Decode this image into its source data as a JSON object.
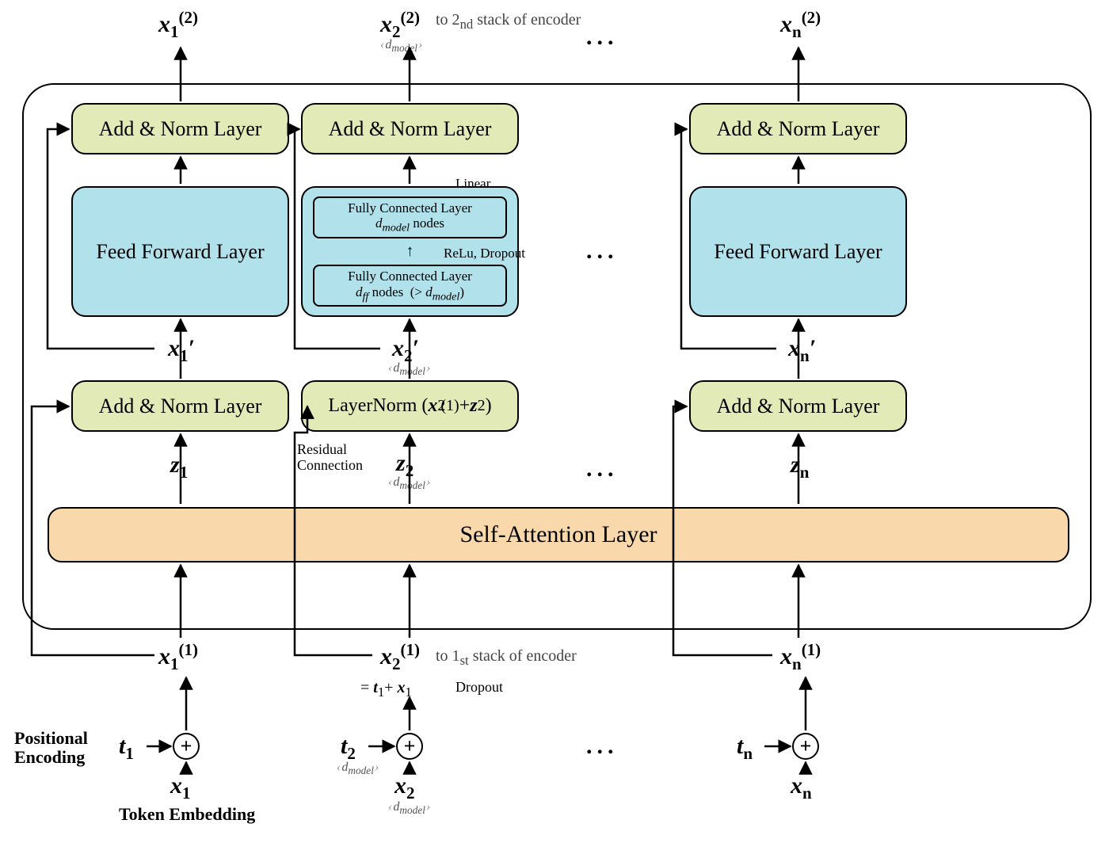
{
  "layers": {
    "addnorm": "Add & Norm Layer",
    "ffn": "Feed Forward Layer",
    "selfattn": "Self-Attention Layer",
    "layernorm_expanded_html": "LayerNorm (<i><b>x</b></i><sub>2</sub><sup style='margin-left:-6px'>(1)</sup>+ <i><b>z</b></i><sub>2</sub>)"
  },
  "ffn_detail": {
    "fc1_html": "Fully Connected Layer<br><span style='font-style:italic'>d<sub>model</sub></span> nodes",
    "fc2_html": "Fully Connected Layer<br><span style='font-style:italic'>d<sub>ff</sub></span> nodes &nbsp;(&gt; <span style='font-style:italic'>d<sub>model</sub></span>)",
    "act": "ReLu, Dropout",
    "linear": "Linear"
  },
  "vars": {
    "x1_2_html": "<i>x</i><sub>1</sub><sup>(2)</sup>",
    "x2_2_html": "<i>x</i><sub>2</sub><sup>(2)</sup>",
    "xn_2_html": "<i>x</i><sub>n</sub><sup>(2)</sup>",
    "x1p_html": "<i>x</i><sub>1</sub>&#x2032;",
    "x2p_html": "<i>x</i><sub>2</sub>&#x2032;",
    "xnp_html": "<i>x</i><sub>n</sub>&#x2032;",
    "z1_html": "<i>z</i><sub>1</sub>",
    "z2_html": "<i>z</i><sub>2</sub>",
    "zn_html": "<i>z</i><sub>n</sub>",
    "x1_1_html": "<i>x</i><sub>1</sub><sup>(1)</sup>",
    "x2_1_html": "<i>x</i><sub>2</sub><sup>(1)</sup>",
    "xn_1_html": "<i>x</i><sub>n</sub><sup>(1)</sup>",
    "t1_html": "<i>t</i><sub>1</sub>",
    "t2_html": "<i>t</i><sub>2</sub>",
    "tn_html": "<i>t</i><sub>n</sub>",
    "x1_html": "<i>x</i><sub>1</sub>",
    "x2_html": "<i>x</i><sub>2</sub>",
    "xn_html": "<i>x</i><sub>n</sub>",
    "eq_html": "= <i><b>t</b></i><sub>1</sub>+ <i><b>x</b></i><sub>1</sub>"
  },
  "notes": {
    "to2nd_html": "to 2<sub>nd</sub> stack of encoder",
    "to1st_html": "to 1<sub>st</sub> stack of encoder",
    "residual": "Residual\nConnection",
    "dropout": "Dropout",
    "pos_enc": "Positional\nEncoding",
    "tok_emb": "Token Embedding",
    "dmodel_html": "d<sub>model</sub>"
  },
  "ell": "..."
}
